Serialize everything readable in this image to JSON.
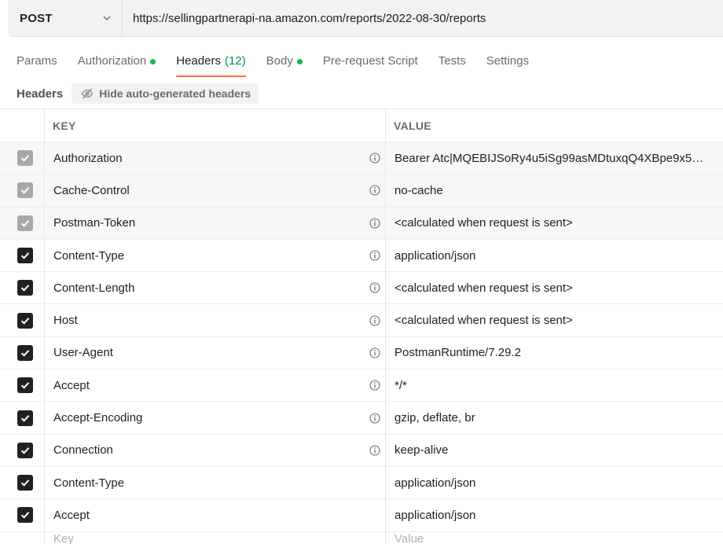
{
  "request": {
    "method": "POST",
    "url": "https://sellingpartnerapi-na.amazon.com/reports/2022-08-30/reports"
  },
  "tabs": [
    {
      "label": "Params",
      "active": false
    },
    {
      "label": "Authorization",
      "active": false,
      "dot": true
    },
    {
      "label": "Headers",
      "count": "(12)",
      "active": true
    },
    {
      "label": "Body",
      "active": false,
      "dot": true
    },
    {
      "label": "Pre-request Script",
      "active": false
    },
    {
      "label": "Tests",
      "active": false
    },
    {
      "label": "Settings",
      "active": false
    }
  ],
  "headers_section": {
    "title": "Headers",
    "hide_button_label": "Hide auto-generated headers"
  },
  "table": {
    "columns": {
      "key": "KEY",
      "value": "VALUE"
    },
    "rows": [
      {
        "key": "Authorization",
        "value": "Bearer Atc|MQEBIJSoRy4u5iSg99asMDtuxqQ4XBpe9x5…",
        "checked": "auto",
        "info": true
      },
      {
        "key": "Cache-Control",
        "value": "no-cache",
        "checked": "auto",
        "info": true
      },
      {
        "key": "Postman-Token",
        "value": "<calculated when request is sent>",
        "checked": "auto",
        "info": true
      },
      {
        "key": "Content-Type",
        "value": "application/json",
        "checked": "on",
        "info": true
      },
      {
        "key": "Content-Length",
        "value": "<calculated when request is sent>",
        "checked": "on",
        "info": true
      },
      {
        "key": "Host",
        "value": "<calculated when request is sent>",
        "checked": "on",
        "info": true
      },
      {
        "key": "User-Agent",
        "value": "PostmanRuntime/7.29.2",
        "checked": "on",
        "info": true
      },
      {
        "key": "Accept",
        "value": "*/*",
        "checked": "on",
        "info": true
      },
      {
        "key": "Accept-Encoding",
        "value": "gzip, deflate, br",
        "checked": "on",
        "info": true
      },
      {
        "key": "Connection",
        "value": "keep-alive",
        "checked": "on",
        "info": true
      },
      {
        "key": "Content-Type",
        "value": "application/json",
        "checked": "on",
        "info": false
      },
      {
        "key": "Accept",
        "value": "application/json",
        "checked": "on",
        "info": false
      }
    ],
    "new_row": {
      "key_placeholder": "Key",
      "value_placeholder": "Value"
    }
  },
  "colors": {
    "active_tab_underline": "#ff6c37",
    "status_dot": "#0cbb52",
    "checkbox_on": "#212121",
    "checkbox_auto": "#a8a8a8"
  }
}
